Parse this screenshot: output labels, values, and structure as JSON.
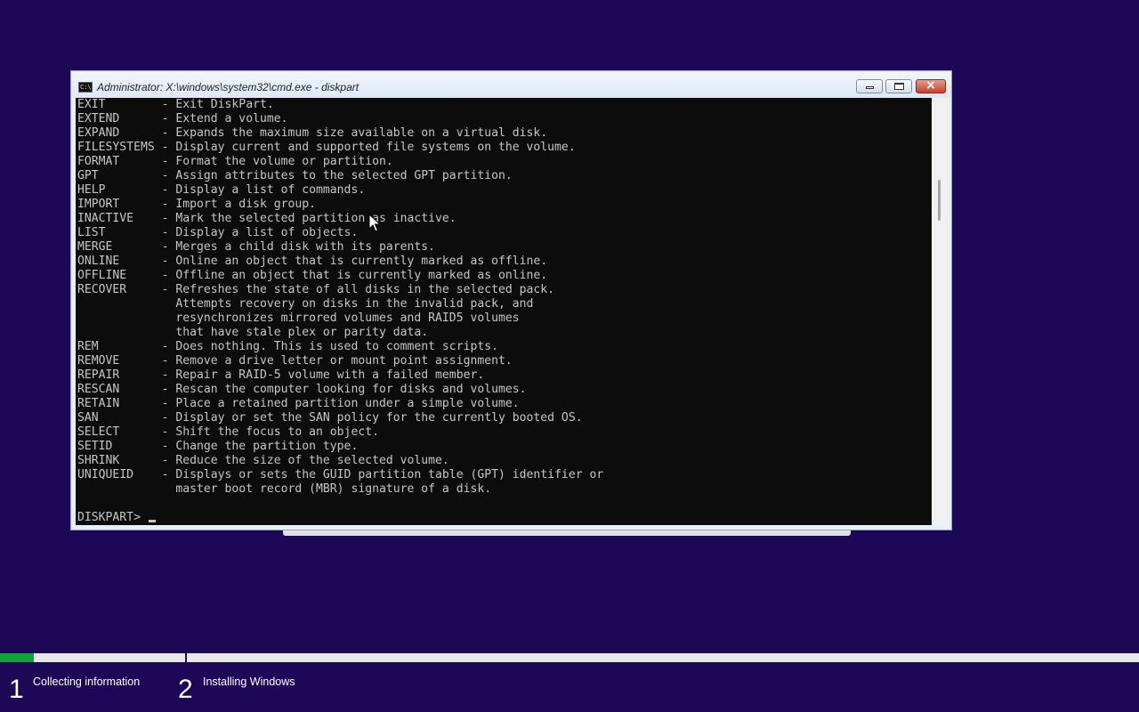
{
  "window": {
    "title": "Administrator: X:\\windows\\system32\\cmd.exe - diskpart",
    "icon": "cmd-console-icon",
    "controls": {
      "minimize": "minimize-icon",
      "maximize": "maximize-icon",
      "close": "×"
    }
  },
  "console": {
    "lines": [
      "EXIT        - Exit DiskPart.",
      "EXTEND      - Extend a volume.",
      "EXPAND      - Expands the maximum size available on a virtual disk.",
      "FILESYSTEMS - Display current and supported file systems on the volume.",
      "FORMAT      - Format the volume or partition.",
      "GPT         - Assign attributes to the selected GPT partition.",
      "HELP        - Display a list of commands.",
      "IMPORT      - Import a disk group.",
      "INACTIVE    - Mark the selected partition as inactive.",
      "LIST        - Display a list of objects.",
      "MERGE       - Merges a child disk with its parents.",
      "ONLINE      - Online an object that is currently marked as offline.",
      "OFFLINE     - Offline an object that is currently marked as online.",
      "RECOVER     - Refreshes the state of all disks in the selected pack.",
      "              Attempts recovery on disks in the invalid pack, and",
      "              resynchronizes mirrored volumes and RAID5 volumes",
      "              that have stale plex or parity data.",
      "REM         - Does nothing. This is used to comment scripts.",
      "REMOVE      - Remove a drive letter or mount point assignment.",
      "REPAIR      - Repair a RAID-5 volume with a failed member.",
      "RESCAN      - Rescan the computer looking for disks and volumes.",
      "RETAIN      - Place a retained partition under a simple volume.",
      "SAN         - Display or set the SAN policy for the currently booted OS.",
      "SELECT      - Shift the focus to an object.",
      "SETID       - Change the partition type.",
      "SHRINK      - Reduce the size of the selected volume.",
      "UNIQUEID    - Displays or sets the GUID partition table (GPT) identifier or",
      "              master boot record (MBR) signature of a disk.",
      ""
    ],
    "prompt": "DISKPART> "
  },
  "setup": {
    "progress_fraction": 0.03,
    "steps": [
      {
        "number": "1",
        "label": "Collecting information"
      },
      {
        "number": "2",
        "label": "Installing Windows"
      }
    ]
  },
  "colors": {
    "background": "#1c0857",
    "console_bg": "#0c0c0c",
    "console_text": "#c6c6c6",
    "progress": "#0fa437"
  }
}
